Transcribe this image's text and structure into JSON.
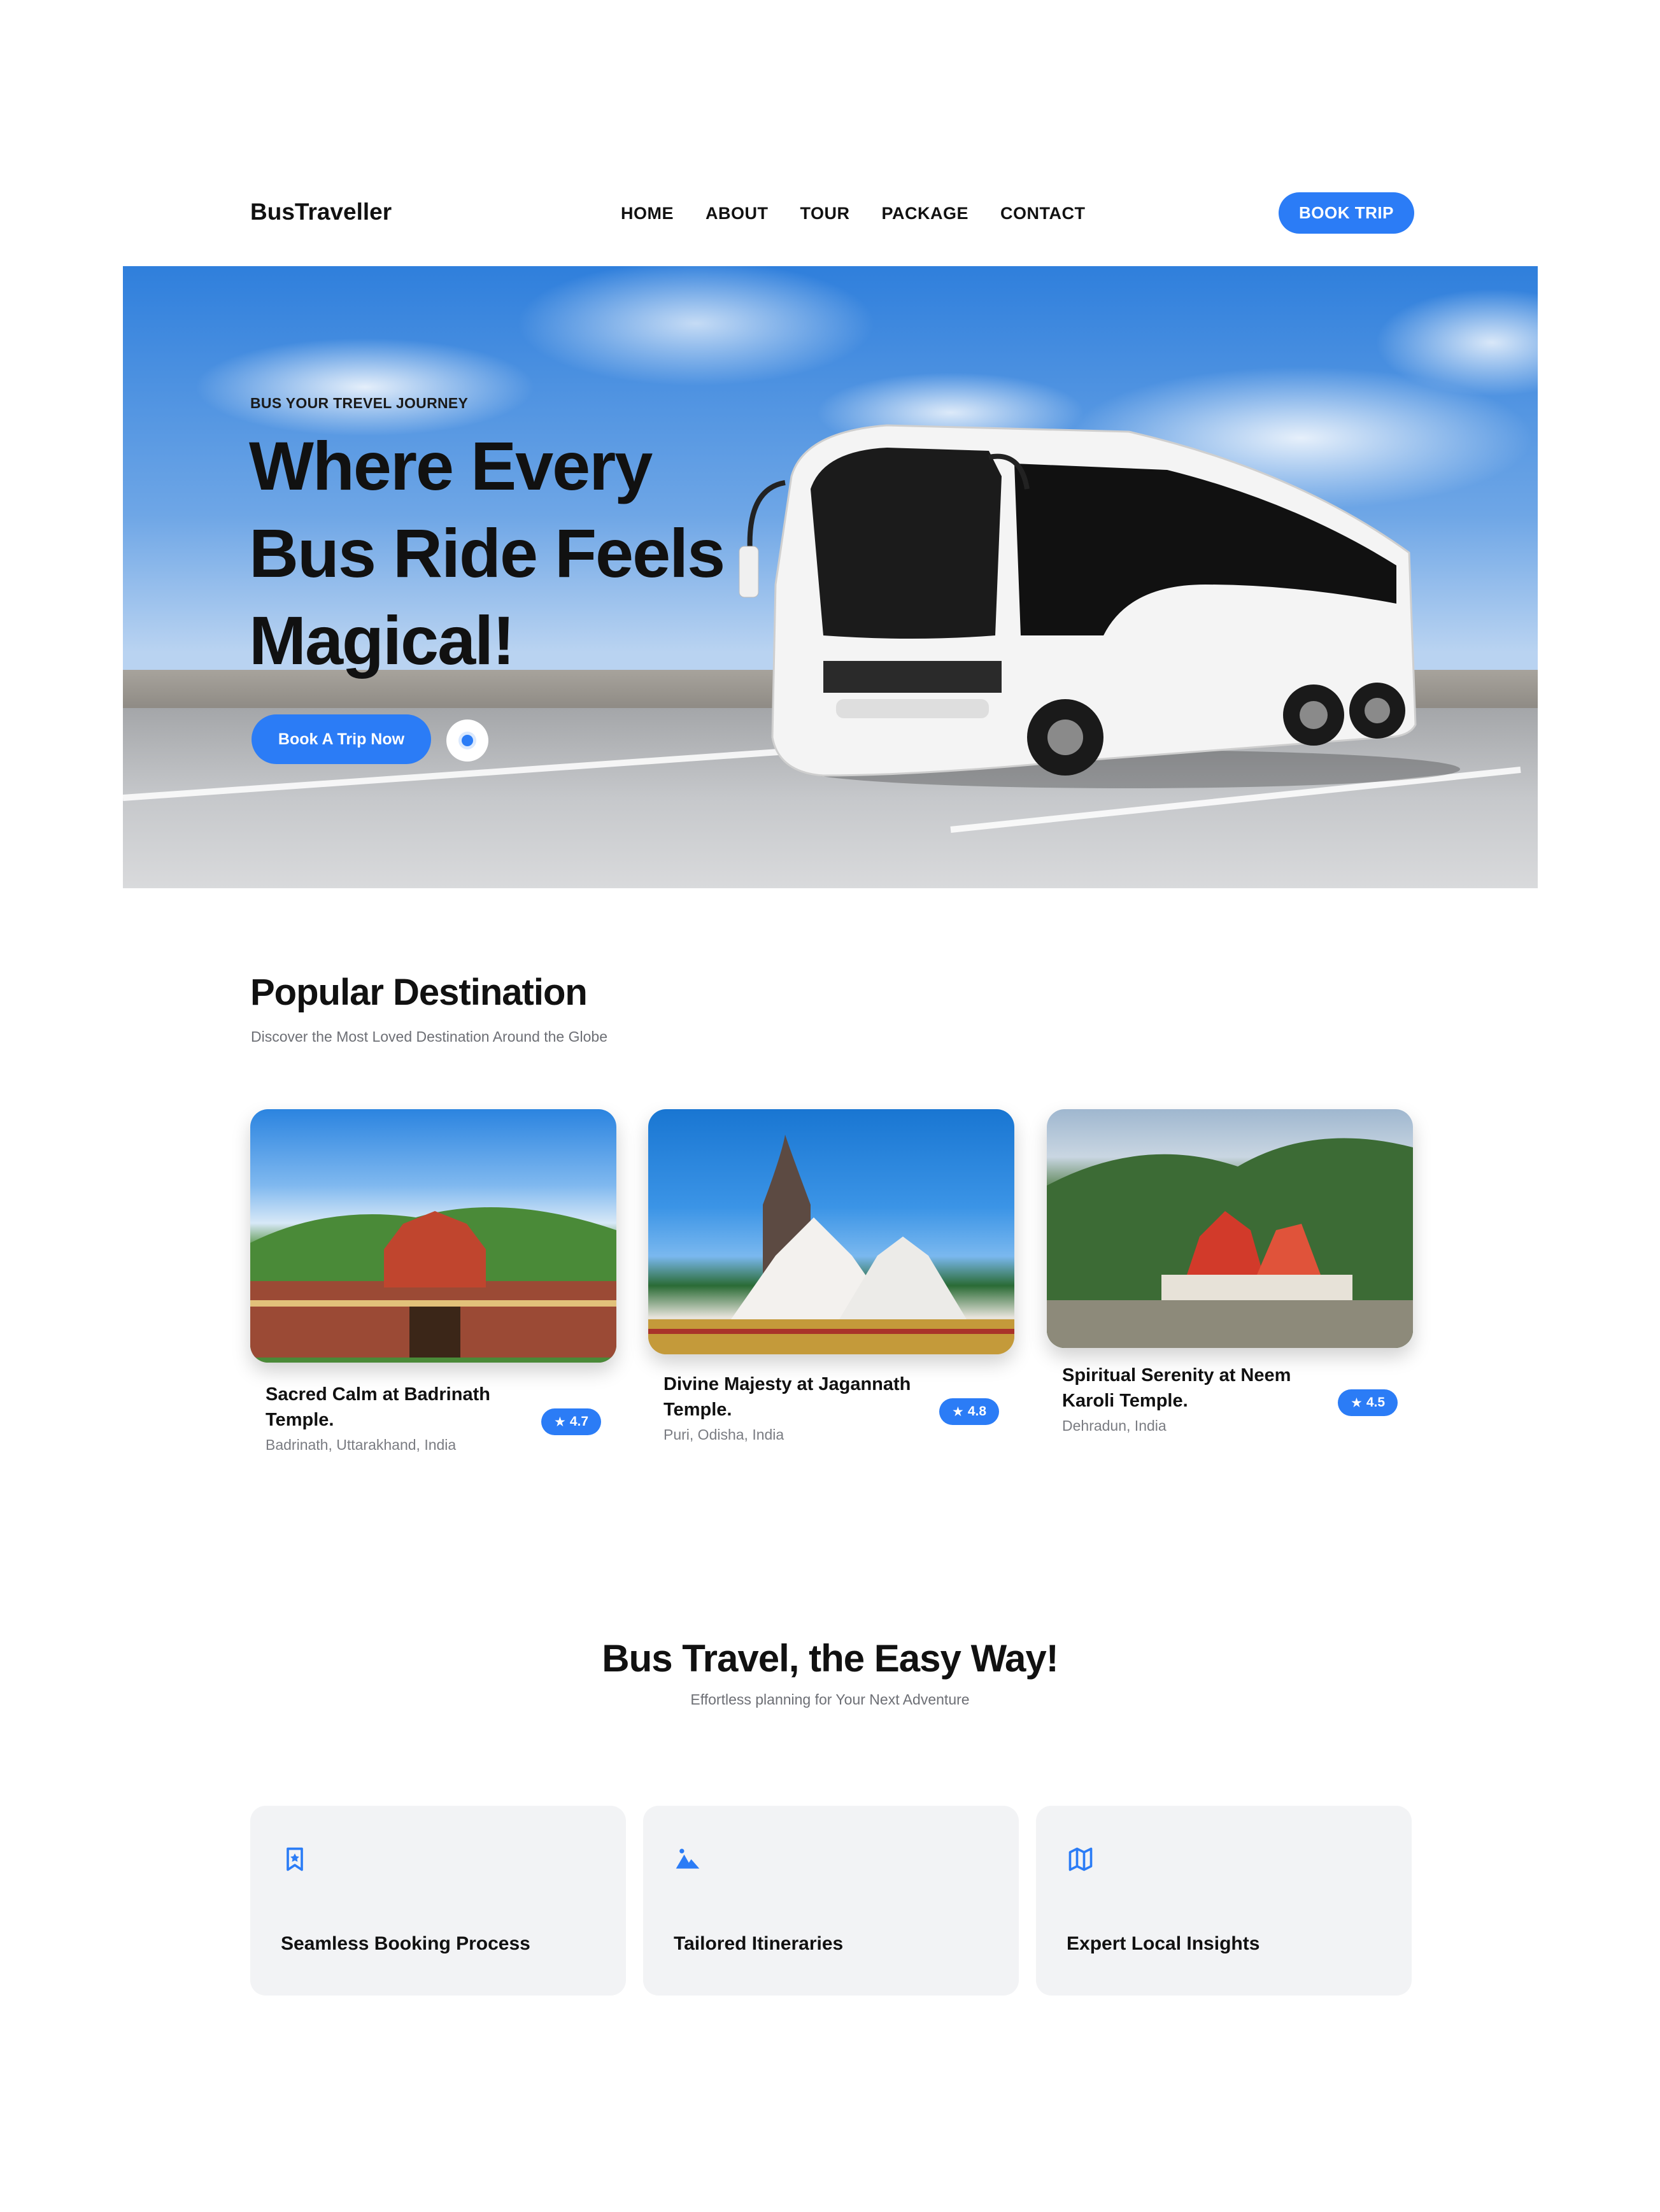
{
  "header": {
    "brand": "BusTraveller",
    "menu": [
      "HOME",
      "ABOUT",
      "TOUR",
      "PACKAGE",
      "CONTACT"
    ],
    "cta": "BOOK TRIP"
  },
  "hero": {
    "tag": "BUS YOUR TREVEL JOURNEY",
    "title_lines": [
      "Where Every",
      "Bus Ride Feels",
      "Magical!"
    ],
    "cta": "Book A Trip Now",
    "play_icon": "play-icon"
  },
  "popular": {
    "title": "Popular Destination",
    "subtitle": "Discover the Most Loved Destination Around the Globe",
    "cards": [
      {
        "name": "Sacred Calm at Badrinath Temple.",
        "location": "Badrinath, Uttarakhand, India",
        "rating": "4.7"
      },
      {
        "name": "Divine Majesty at Jagannath Temple.",
        "location": "Puri, Odisha, India",
        "rating": "4.8"
      },
      {
        "name": "Spiritual Serenity at Neem Karoli Temple.",
        "location": "Dehradun, India",
        "rating": "4.5"
      }
    ]
  },
  "easy": {
    "title": "Bus Travel, the Easy Way!",
    "subtitle": "Effortless planning for Your Next Adventure",
    "features": [
      {
        "label": "Seamless Booking Process",
        "icon": "bookmark-star-icon"
      },
      {
        "label": "Tailored Itineraries",
        "icon": "mountain-icon"
      },
      {
        "label": "Expert Local Insights",
        "icon": "map-icon"
      }
    ]
  },
  "colors": {
    "accent": "#2b7cf6",
    "text": "#111111",
    "muted": "#6d6f75",
    "card_bg": "#f2f3f5"
  }
}
